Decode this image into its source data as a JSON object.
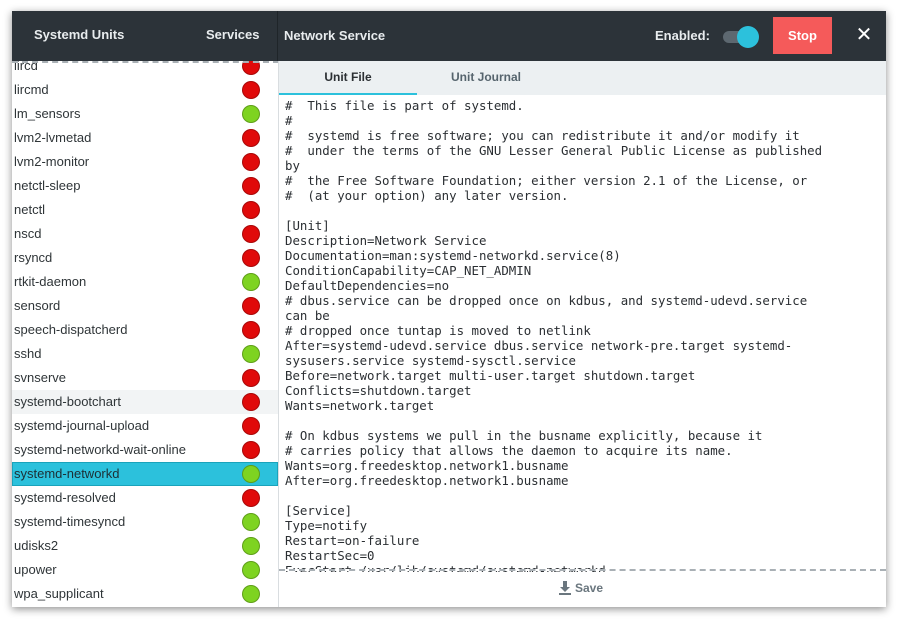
{
  "header": {
    "app_title": "Systemd Units",
    "services_label": "Services",
    "unit_title": "Network Service",
    "enabled_label": "Enabled:",
    "enabled": true,
    "stop_label": "Stop",
    "close_icon": "close-icon"
  },
  "colors": {
    "header_bg": "#2c3339",
    "toggle_on": "#2cc1dc",
    "stop_bg": "#f55a5a",
    "status_active": "#7ed321",
    "status_inactive": "#e00a0a",
    "selection": "#2cc1dc"
  },
  "units": [
    {
      "name": "lircd",
      "active": false
    },
    {
      "name": "lircmd",
      "active": false
    },
    {
      "name": "lm_sensors",
      "active": true
    },
    {
      "name": "lvm2-lvmetad",
      "active": false
    },
    {
      "name": "lvm2-monitor",
      "active": false
    },
    {
      "name": "netctl-sleep",
      "active": false
    },
    {
      "name": "netctl",
      "active": false
    },
    {
      "name": "nscd",
      "active": false
    },
    {
      "name": "rsyncd",
      "active": false
    },
    {
      "name": "rtkit-daemon",
      "active": true
    },
    {
      "name": "sensord",
      "active": false
    },
    {
      "name": "speech-dispatcherd",
      "active": false
    },
    {
      "name": "sshd",
      "active": true
    },
    {
      "name": "svnserve",
      "active": false
    },
    {
      "name": "systemd-bootchart",
      "active": false,
      "hover": true
    },
    {
      "name": "systemd-journal-upload",
      "active": false
    },
    {
      "name": "systemd-networkd-wait-online",
      "active": false
    },
    {
      "name": "systemd-networkd",
      "active": true,
      "selected": true
    },
    {
      "name": "systemd-resolved",
      "active": false
    },
    {
      "name": "systemd-timesyncd",
      "active": true
    },
    {
      "name": "udisks2",
      "active": true
    },
    {
      "name": "upower",
      "active": true
    },
    {
      "name": "wpa_supplicant",
      "active": true
    }
  ],
  "tabs": {
    "unit_file": "Unit File",
    "unit_journal": "Unit Journal"
  },
  "unit_file_text": "#  This file is part of systemd.\n#\n#  systemd is free software; you can redistribute it and/or modify it\n#  under the terms of the GNU Lesser General Public License as published\nby\n#  the Free Software Foundation; either version 2.1 of the License, or\n#  (at your option) any later version.\n\n[Unit]\nDescription=Network Service\nDocumentation=man:systemd-networkd.service(8)\nConditionCapability=CAP_NET_ADMIN\nDefaultDependencies=no\n# dbus.service can be dropped once on kdbus, and systemd-udevd.service\ncan be\n# dropped once tuntap is moved to netlink\nAfter=systemd-udevd.service dbus.service network-pre.target systemd-\nsysusers.service systemd-sysctl.service\nBefore=network.target multi-user.target shutdown.target\nConflicts=shutdown.target\nWants=network.target\n\n# On kdbus systems we pull in the busname explicitly, because it\n# carries policy that allows the daemon to acquire its name.\nWants=org.freedesktop.network1.busname\nAfter=org.freedesktop.network1.busname\n\n[Service]\nType=notify\nRestart=on-failure\nRestartSec=0\nExecStart=/usr/lib/systemd/systemd-networkd",
  "footer": {
    "save_label": "Save",
    "save_icon": "download-icon"
  }
}
